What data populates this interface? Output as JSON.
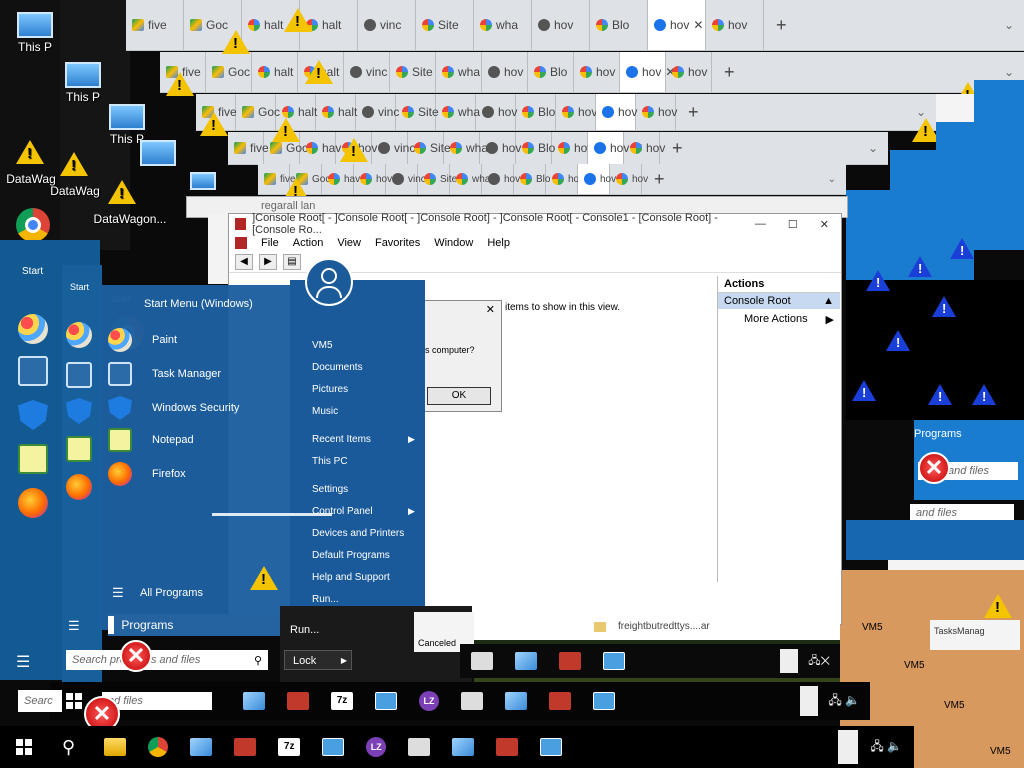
{
  "desktop": {
    "icons": [
      {
        "label": "This P"
      },
      {
        "label": "This P"
      },
      {
        "label": "This P"
      },
      {
        "label": "DataWag"
      },
      {
        "label": "DataWag"
      },
      {
        "label": "DataWagon..."
      }
    ]
  },
  "browser_tabs": [
    "five",
    "Goc",
    "halt",
    "vinc",
    "Site",
    "wha",
    "hov",
    "Blo",
    "hov",
    "hov"
  ],
  "browser_tabs_short": [
    "five",
    "Goc",
    "hav",
    "hov",
    "vinc",
    "Site",
    "wha",
    "hov",
    "Blo",
    "hov",
    "hov"
  ],
  "console": {
    "window_title": "]Console Root[ - ]Console Root[ - ]Console Root] - ]Console Root[ - Console1 - [Console Root] - [Console Ro...",
    "menu": [
      "File",
      "Action",
      "View",
      "Favorites",
      "Window",
      "Help"
    ],
    "empty_message": "items to show in this view.",
    "actions_header": "Actions",
    "actions_selected": "Console Root",
    "actions_more": "More Actions",
    "behind_title": "regarall lan"
  },
  "dialog": {
    "text": "is computer?",
    "ok_label": "OK"
  },
  "start_menu": {
    "title": "Start Menu (Windows)",
    "tile_label": "Start",
    "pinned": [
      "Paint",
      "Task Manager",
      "Windows Security",
      "Notepad",
      "Firefox"
    ],
    "right_items": [
      "VM5",
      "Documents",
      "Pictures",
      "Music",
      "Recent Items",
      "This PC",
      "Settings",
      "Control Panel",
      "Devices and Printers",
      "Default Programs",
      "Help and Support",
      "Run..."
    ],
    "all_programs": "All Programs",
    "programs": "Programs",
    "run_label": "Run...",
    "lock_label": "Lock",
    "search_placeholder": "Search programs and files",
    "search_short": "nd files",
    "search_left": "Searc",
    "canceled": "Canceled",
    "file_label": "freightbutredttys....ar"
  },
  "right_panel": {
    "programs": "Programs",
    "and_files": "and files",
    "vm_label": "VM5",
    "tasks_label": "TasksManag"
  }
}
